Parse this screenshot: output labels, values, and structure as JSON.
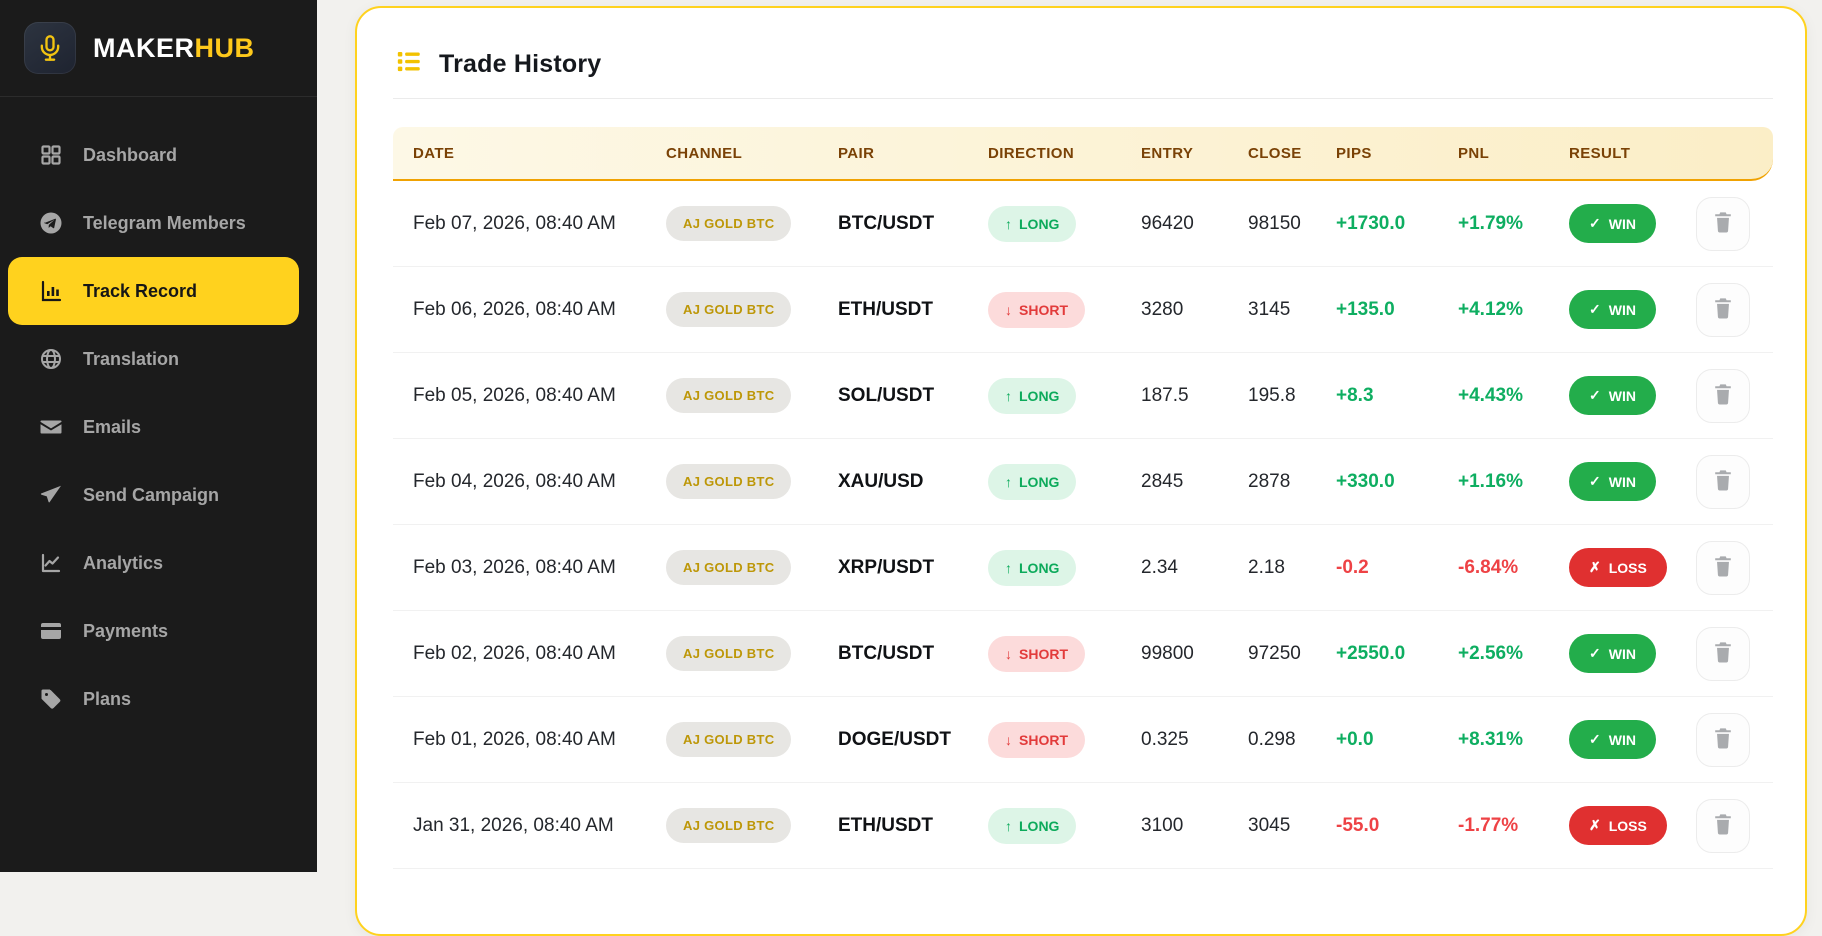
{
  "brand": {
    "name_primary": "MAKER",
    "name_secondary": "HUB",
    "logo_icon": "microphone-icon"
  },
  "sidebar": {
    "items": [
      {
        "label": "Dashboard",
        "icon": "dashboard-grid-icon",
        "active": false
      },
      {
        "label": "Telegram Members",
        "icon": "telegram-icon",
        "active": false
      },
      {
        "label": "Track Record",
        "icon": "bar-chart-icon",
        "active": true
      },
      {
        "label": "Translation",
        "icon": "globe-icon",
        "active": false
      },
      {
        "label": "Emails",
        "icon": "envelope-icon",
        "active": false
      },
      {
        "label": "Send Campaign",
        "icon": "paper-plane-icon",
        "active": false
      },
      {
        "label": "Analytics",
        "icon": "line-chart-icon",
        "active": false
      },
      {
        "label": "Payments",
        "icon": "credit-card-icon",
        "active": false
      },
      {
        "label": "Plans",
        "icon": "tag-icon",
        "active": false
      }
    ]
  },
  "main": {
    "title": "Trade History",
    "title_icon": "list-icon",
    "table": {
      "columns": [
        "DATE",
        "CHANNEL",
        "PAIR",
        "DIRECTION",
        "ENTRY",
        "CLOSE",
        "PIPS",
        "PNL",
        "RESULT"
      ],
      "rows": [
        {
          "date": "Feb 07, 2026, 08:40 AM",
          "channel": "AJ GOLD BTC",
          "pair": "BTC/USDT",
          "direction": "LONG",
          "direction_arrow": "↑",
          "entry": "96420",
          "close": "98150",
          "pips": "+1730.0",
          "pnl": "+1.79%",
          "result": "WIN",
          "result_icon": "✓"
        },
        {
          "date": "Feb 06, 2026, 08:40 AM",
          "channel": "AJ GOLD BTC",
          "pair": "ETH/USDT",
          "direction": "SHORT",
          "direction_arrow": "↓",
          "entry": "3280",
          "close": "3145",
          "pips": "+135.0",
          "pnl": "+4.12%",
          "result": "WIN",
          "result_icon": "✓"
        },
        {
          "date": "Feb 05, 2026, 08:40 AM",
          "channel": "AJ GOLD BTC",
          "pair": "SOL/USDT",
          "direction": "LONG",
          "direction_arrow": "↑",
          "entry": "187.5",
          "close": "195.8",
          "pips": "+8.3",
          "pnl": "+4.43%",
          "result": "WIN",
          "result_icon": "✓"
        },
        {
          "date": "Feb 04, 2026, 08:40 AM",
          "channel": "AJ GOLD BTC",
          "pair": "XAU/USD",
          "direction": "LONG",
          "direction_arrow": "↑",
          "entry": "2845",
          "close": "2878",
          "pips": "+330.0",
          "pnl": "+1.16%",
          "result": "WIN",
          "result_icon": "✓"
        },
        {
          "date": "Feb 03, 2026, 08:40 AM",
          "channel": "AJ GOLD BTC",
          "pair": "XRP/USDT",
          "direction": "LONG",
          "direction_arrow": "↑",
          "entry": "2.34",
          "close": "2.18",
          "pips": "-0.2",
          "pnl": "-6.84%",
          "result": "LOSS",
          "result_icon": "✗"
        },
        {
          "date": "Feb 02, 2026, 08:40 AM",
          "channel": "AJ GOLD BTC",
          "pair": "BTC/USDT",
          "direction": "SHORT",
          "direction_arrow": "↓",
          "entry": "99800",
          "close": "97250",
          "pips": "+2550.0",
          "pnl": "+2.56%",
          "result": "WIN",
          "result_icon": "✓"
        },
        {
          "date": "Feb 01, 2026, 08:40 AM",
          "channel": "AJ GOLD BTC",
          "pair": "DOGE/USDT",
          "direction": "SHORT",
          "direction_arrow": "↓",
          "entry": "0.325",
          "close": "0.298",
          "pips": "+0.0",
          "pnl": "+8.31%",
          "result": "WIN",
          "result_icon": "✓"
        },
        {
          "date": "Jan 31, 2026, 08:40 AM",
          "channel": "AJ GOLD BTC",
          "pair": "ETH/USDT",
          "direction": "LONG",
          "direction_arrow": "↑",
          "entry": "3100",
          "close": "3045",
          "pips": "-55.0",
          "pnl": "-1.77%",
          "result": "LOSS",
          "result_icon": "✗"
        }
      ]
    }
  },
  "colors": {
    "accent_yellow": "#ffd21e",
    "header_border_amber": "#f0a202",
    "header_text_brown": "#7a4206",
    "win_green": "#23ad4b",
    "loss_red": "#e03030",
    "positive_text": "#0eae61",
    "negative_text": "#ee4245",
    "sidebar_bg": "#1b1b1b",
    "channel_gold": "#bd9708"
  }
}
